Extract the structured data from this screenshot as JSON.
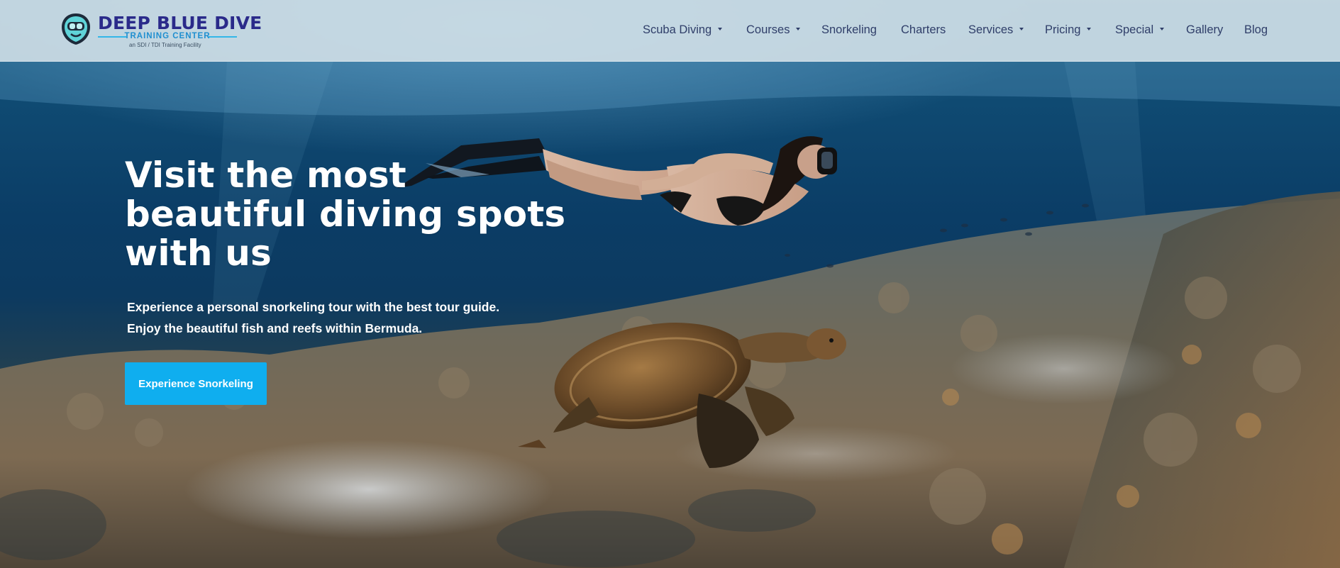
{
  "brand": {
    "name": "DEEP BLUE DIVE",
    "subtitle": "TRAINING CENTER",
    "tagline": "an SDI / TDI Training Facility",
    "logo_icon": "diver-mask-icon",
    "colors": {
      "title": "#2a2a8a",
      "accent": "#1f8fd0"
    }
  },
  "nav": {
    "items": [
      {
        "label": "Scuba Diving",
        "has_dropdown": true
      },
      {
        "label": "Courses",
        "has_dropdown": true
      },
      {
        "label": "Snorkeling",
        "has_dropdown": false
      },
      {
        "label": "Charters",
        "has_dropdown": false
      },
      {
        "label": "Services",
        "has_dropdown": true
      },
      {
        "label": "Pricing",
        "has_dropdown": true
      },
      {
        "label": "Special",
        "has_dropdown": true
      },
      {
        "label": "Gallery",
        "has_dropdown": false
      },
      {
        "label": "Blog",
        "has_dropdown": false
      }
    ],
    "color": "#2f3e69"
  },
  "hero": {
    "title_lines": [
      "Visit the most",
      "beautiful diving spots",
      "with us"
    ],
    "description_lines": [
      "Experience a personal snorkeling tour with the best tour guide.",
      "Enjoy the beautiful fish and reefs within Bermuda."
    ],
    "cta_label": "Experience Snorkeling",
    "cta_color": "#0faeef",
    "background_image": "underwater-snorkeler-and-sea-turtle-over-reef"
  }
}
